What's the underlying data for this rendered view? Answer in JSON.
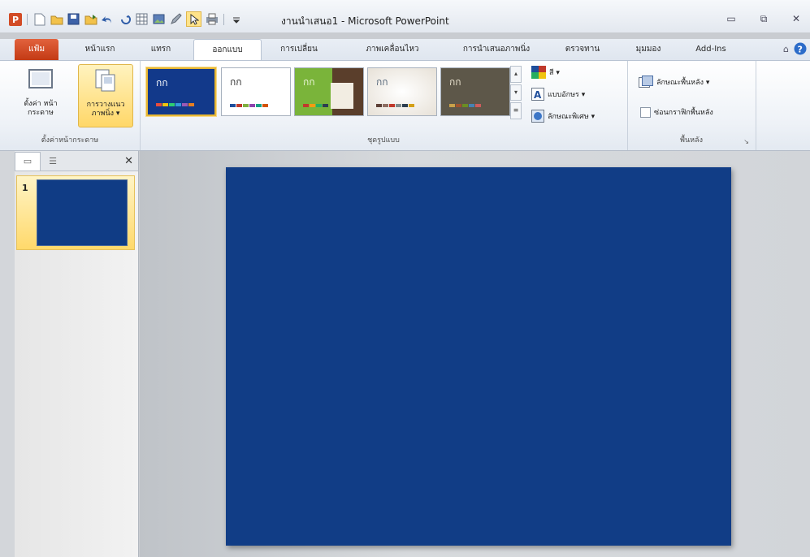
{
  "window": {
    "title": "งานนำเสนอ1 - Microsoft PowerPoint"
  },
  "tabs": [
    {
      "label": "แฟ้ม"
    },
    {
      "label": "หน้าแรก"
    },
    {
      "label": "แทรก"
    },
    {
      "label": "ออกแบบ"
    },
    {
      "label": "การเปลี่ยน"
    },
    {
      "label": "ภาพเคลื่อนไหว"
    },
    {
      "label": "การนำเสนอภาพนิ่ง"
    },
    {
      "label": "ตรวจทาน"
    },
    {
      "label": "มุมมอง"
    },
    {
      "label": "Add-Ins"
    }
  ],
  "page_setup_group": {
    "label": "ตั้งค่าหน้ากระดาษ",
    "page_setup_button": "ตั้งค่า หน้ากระดาษ",
    "orientation_button": "การวางแนว ภาพนิ่ง ▾"
  },
  "themes_group": {
    "label": "ชุดรูปแบบ",
    "themes": [
      {
        "text": "กก"
      },
      {
        "text": "กก"
      },
      {
        "text": "กก"
      },
      {
        "text": "กก"
      },
      {
        "text": "กก"
      }
    ],
    "colors_label": "สี ▾",
    "fonts_label": "แบบอักษร ▾",
    "effects_label": "ลักษณะพิเศษ ▾"
  },
  "background_group": {
    "label": "พื้นหลัง",
    "styles_label": "ลักษณะพื้นหลัง ▾",
    "hide_graphics_label": "ซ่อนกราฟิกพื้นหลัง"
  },
  "slides_pane": {
    "slide_number": "1"
  },
  "colors": {
    "slide_bg": "#113d86",
    "file_tab": "#d24b25",
    "selection": "#ffd96b"
  }
}
